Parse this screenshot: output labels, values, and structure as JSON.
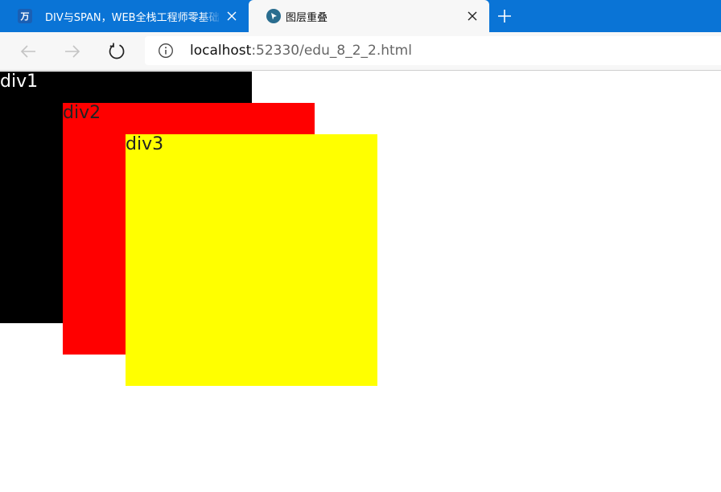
{
  "tabs": [
    {
      "title": "DIV与SPAN，WEB全栈工程师零基础",
      "favicon": "wan-favicon",
      "favicon_text": "万",
      "active": false
    },
    {
      "title": "图层重叠",
      "favicon": "edge-cursor-favicon",
      "active": true
    }
  ],
  "toolbar": {
    "url_host": "localhost",
    "url_path": ":52330/edu_8_2_2.html"
  },
  "page": {
    "boxes": [
      {
        "label": "div1",
        "color": "#000000"
      },
      {
        "label": "div2",
        "color": "#ff0000"
      },
      {
        "label": "div3",
        "color": "#ffff00"
      }
    ]
  },
  "colors": {
    "tabstrip": "#0a74d6",
    "toolbar": "#f7f7f7"
  }
}
